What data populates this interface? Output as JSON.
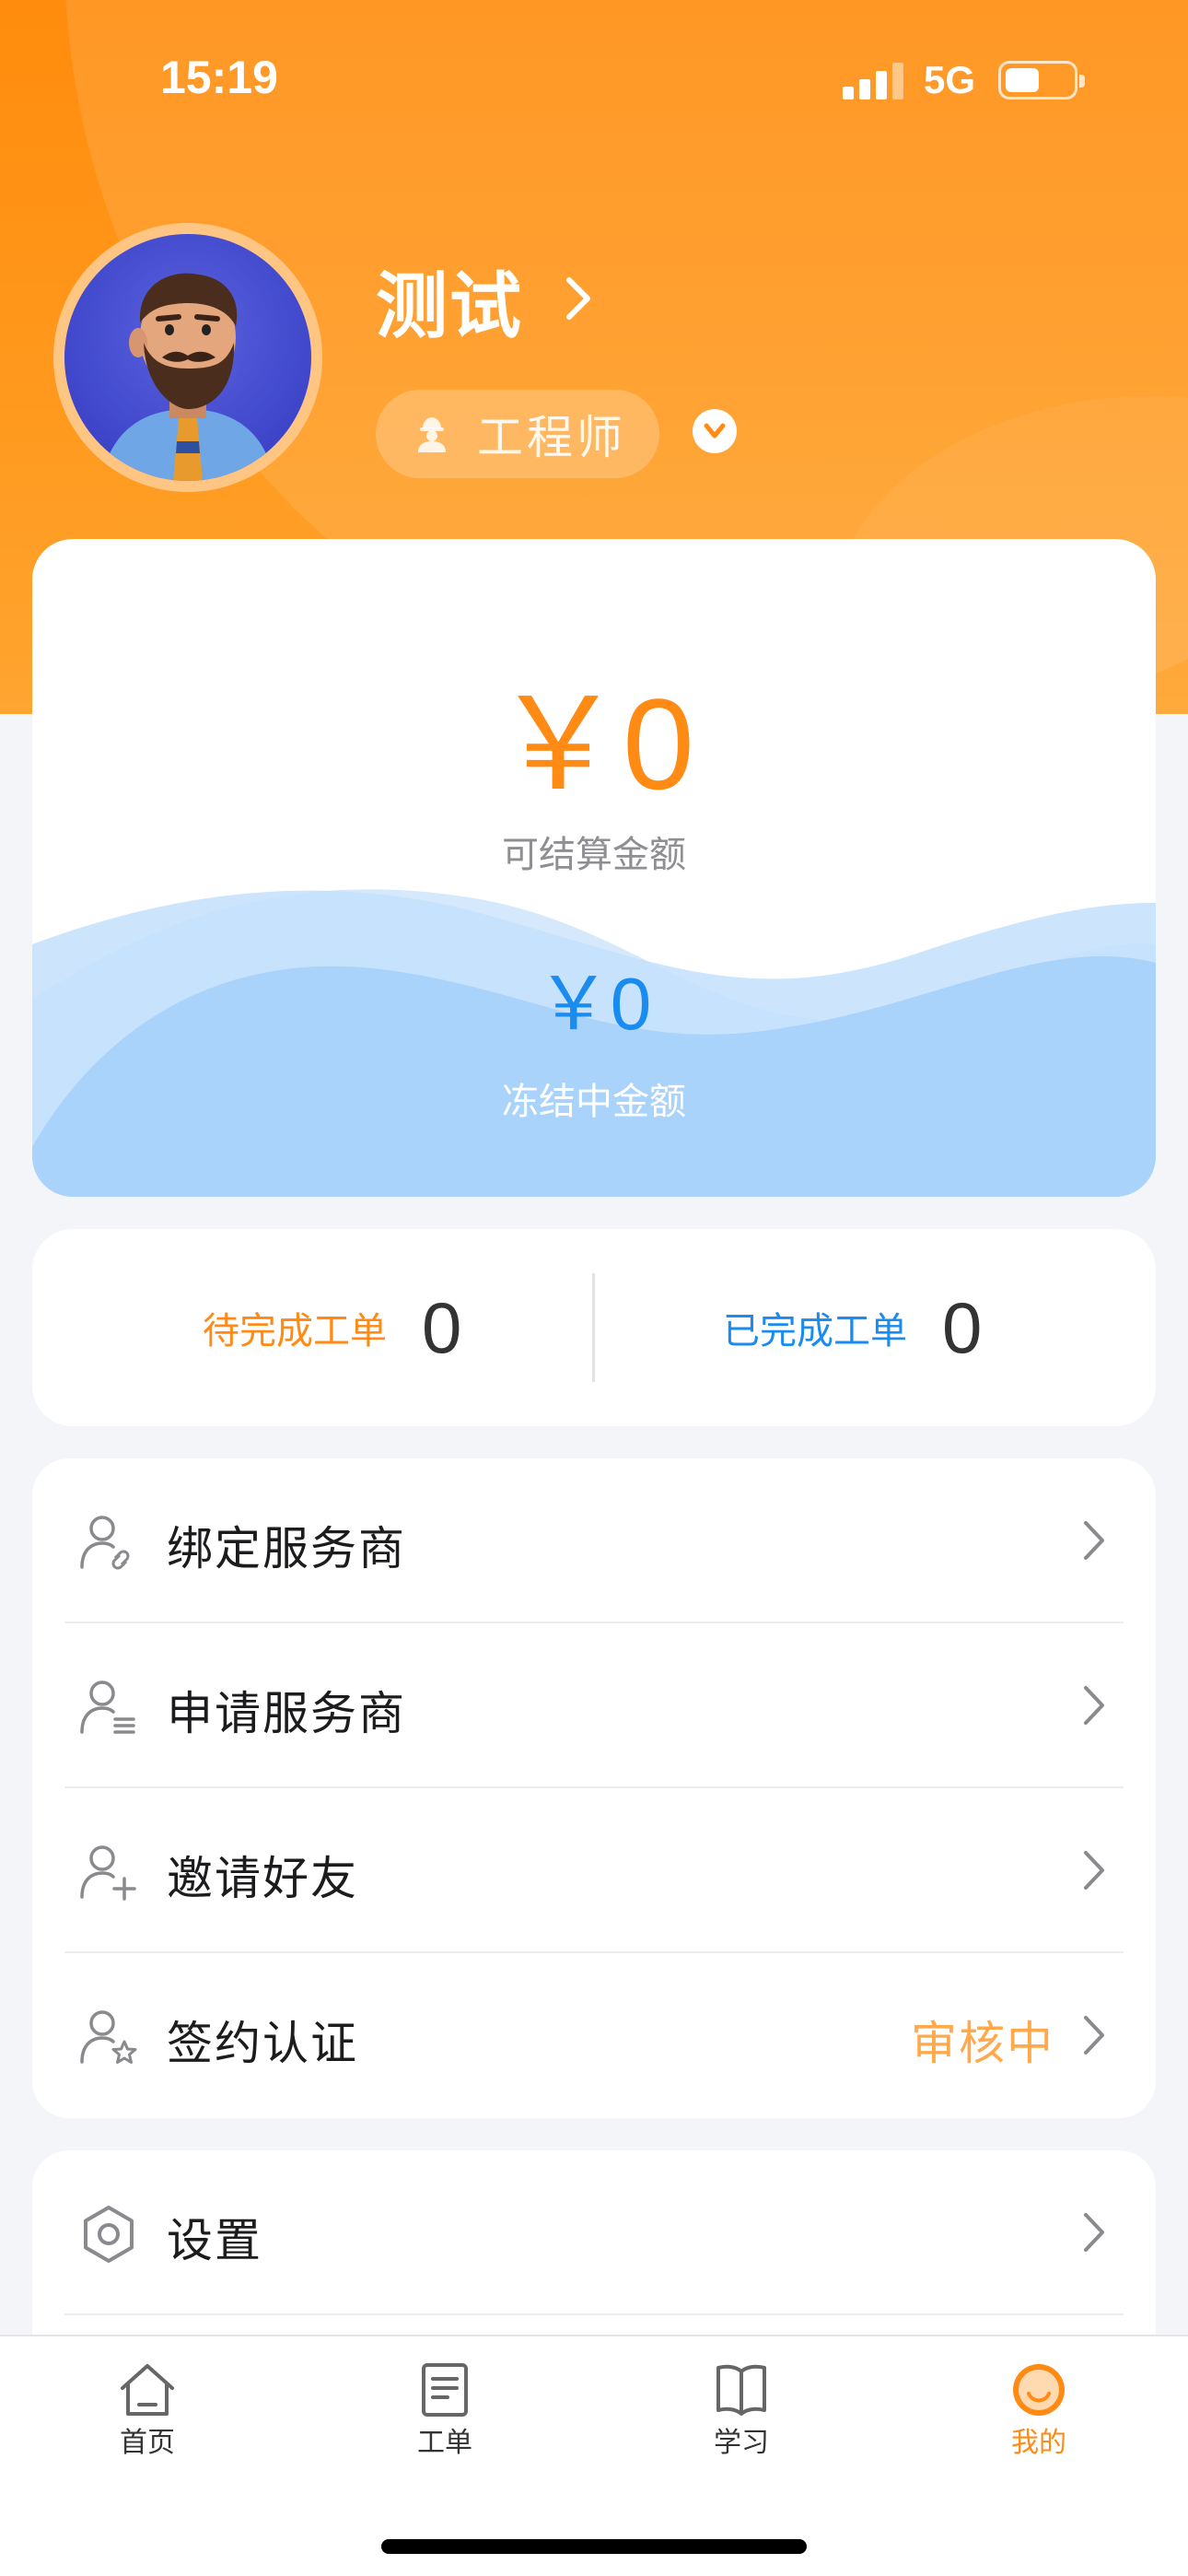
{
  "status_bar": {
    "time": "15:19",
    "network": "5G"
  },
  "profile": {
    "name": "测试",
    "role": "工程师"
  },
  "balance": {
    "settle_amount": "￥0",
    "settle_label": "可结算金额",
    "frozen_amount": "￥0",
    "frozen_label": "冻结中金额"
  },
  "orders": {
    "pending_label": "待完成工单",
    "pending_count": "0",
    "completed_label": "已完成工单",
    "completed_count": "0"
  },
  "menu": {
    "items": [
      {
        "label": "绑定服务商",
        "icon": "user-link-icon"
      },
      {
        "label": "申请服务商",
        "icon": "user-list-icon"
      },
      {
        "label": "邀请好友",
        "icon": "user-add-icon"
      },
      {
        "label": "签约认证",
        "icon": "user-star-icon",
        "status": "审核中"
      }
    ],
    "settings": {
      "label": "设置",
      "icon": "settings-hexagon-icon"
    }
  },
  "tabbar": {
    "tabs": [
      {
        "label": "首页",
        "icon": "home-icon"
      },
      {
        "label": "工单",
        "icon": "document-icon"
      },
      {
        "label": "学习",
        "icon": "book-icon"
      },
      {
        "label": "我的",
        "icon": "profile-face-icon",
        "active": true
      }
    ]
  },
  "colors": {
    "brand_orange": "#ff8a14",
    "accent_blue": "#1a8cf0",
    "status_pending": "#ffa94d",
    "page_bg": "#f4f5f9"
  }
}
